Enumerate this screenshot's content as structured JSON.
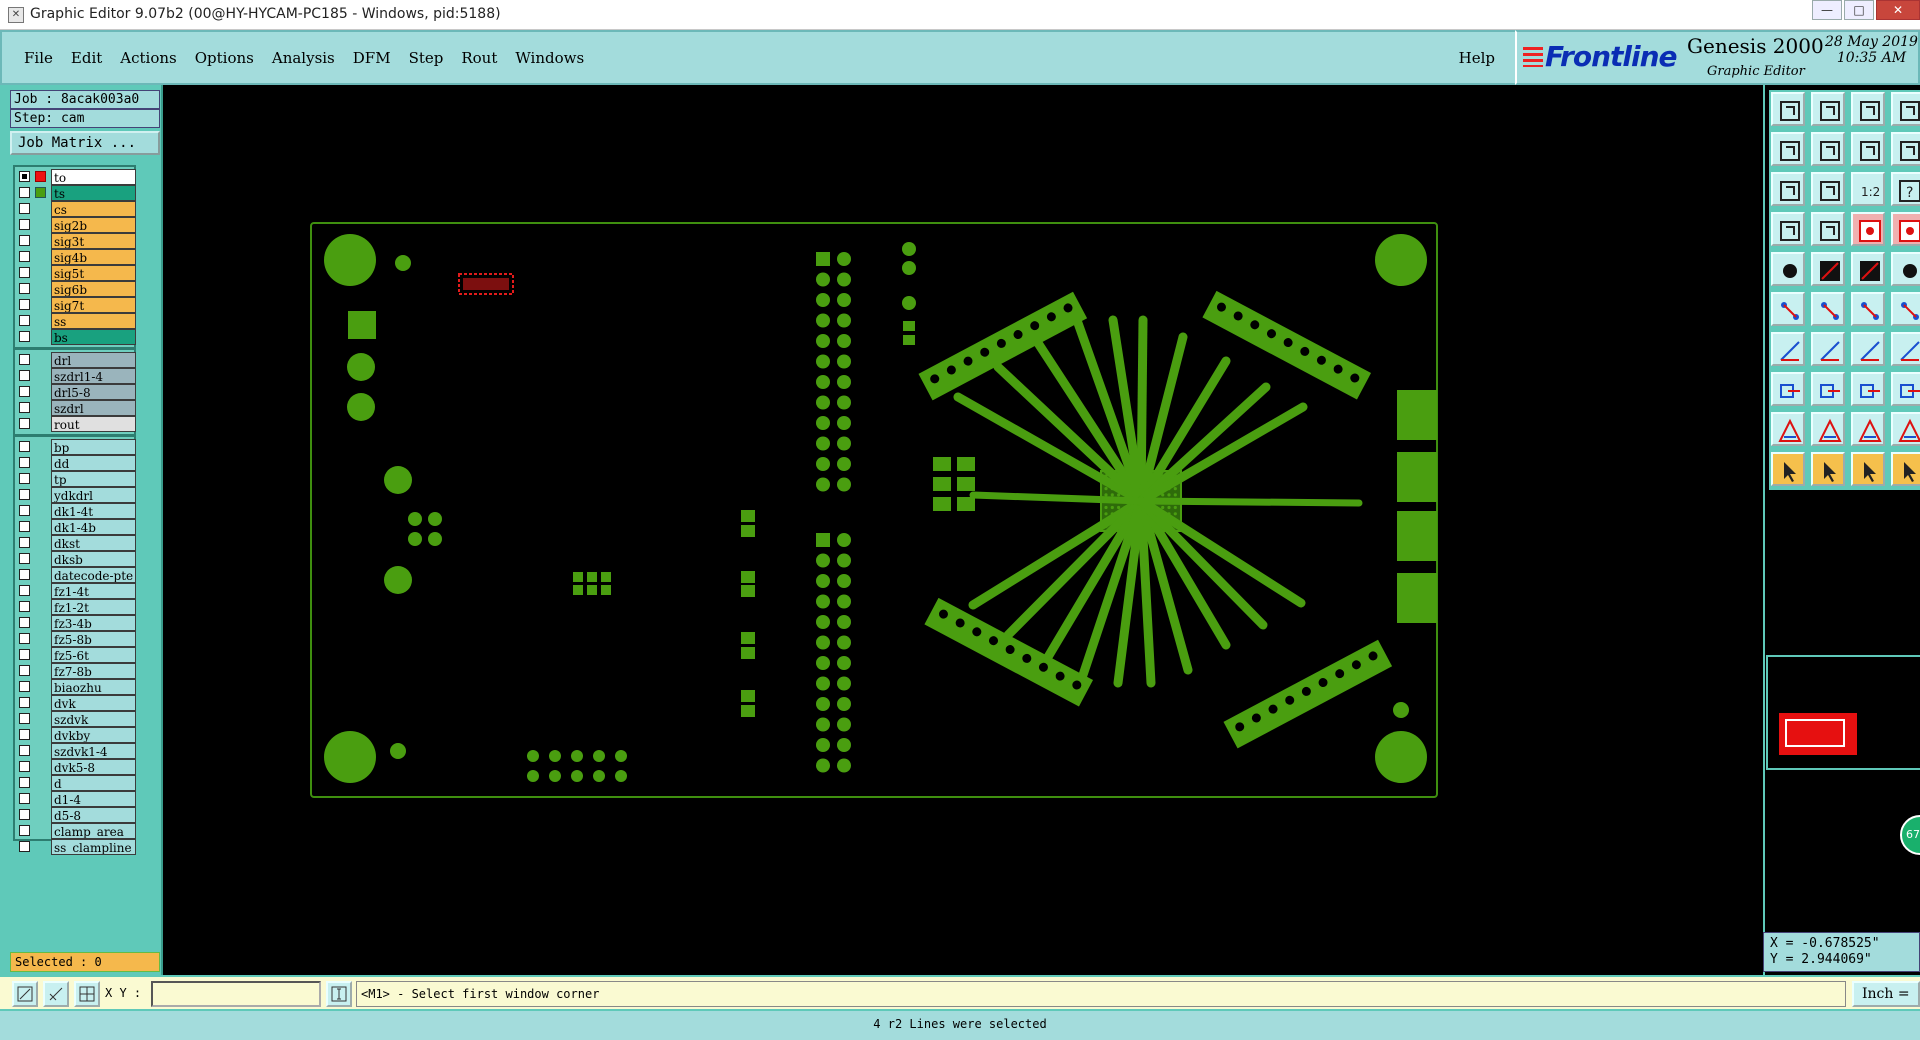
{
  "window": {
    "title": "Graphic Editor 9.07b2 (00@HY-HYCAM-PC185 - Windows, pid:5188)",
    "icon": "app-icon",
    "controls": [
      "minimize",
      "maximize",
      "close"
    ]
  },
  "menubar": {
    "items": [
      "File",
      "Edit",
      "Actions",
      "Options",
      "Analysis",
      "DFM",
      "Step",
      "Rout",
      "Windows"
    ],
    "help": "Help"
  },
  "brand": {
    "logo": "Frontline",
    "product": "Genesis 2000",
    "subtitle": "Graphic Editor",
    "date": "28 May 2019",
    "time": "10:35 AM"
  },
  "job": {
    "job_label": "Job : 8acak003a0",
    "step_label": "Step: cam",
    "matrix_button": "Job Matrix ..."
  },
  "layers": {
    "board": [
      {
        "name": "to",
        "color": "#ffffff",
        "active": true
      },
      {
        "name": "ts",
        "color": "#19a17f"
      },
      {
        "name": "cs",
        "color": "#f5b84c"
      },
      {
        "name": "sig2b",
        "color": "#f5b84c"
      },
      {
        "name": "sig3t",
        "color": "#f5b84c"
      },
      {
        "name": "sig4b",
        "color": "#f5b84c"
      },
      {
        "name": "sig5t",
        "color": "#f5b84c"
      },
      {
        "name": "sig6b",
        "color": "#f5b84c"
      },
      {
        "name": "sig7t",
        "color": "#f5b84c"
      },
      {
        "name": "ss",
        "color": "#f5b84c"
      },
      {
        "name": "bs",
        "color": "#19a17f"
      }
    ],
    "drill": [
      {
        "name": "drl",
        "color": "#9ab4bc"
      },
      {
        "name": "szdrl1-4",
        "color": "#9ab4bc"
      },
      {
        "name": "drl5-8",
        "color": "#9ab4bc"
      },
      {
        "name": "szdrl",
        "color": "#9ab4bc"
      },
      {
        "name": "rout",
        "color": "#e0e0e0"
      }
    ],
    "misc": [
      {
        "name": "bp",
        "color": "#a3dcdc"
      },
      {
        "name": "dd",
        "color": "#a3dcdc"
      },
      {
        "name": "tp",
        "color": "#a3dcdc"
      },
      {
        "name": "ydkdrl",
        "color": "#a3dcdc"
      },
      {
        "name": "dk1-4t",
        "color": "#a3dcdc"
      },
      {
        "name": "dk1-4b",
        "color": "#a3dcdc"
      },
      {
        "name": "dkst",
        "color": "#a3dcdc"
      },
      {
        "name": "dksb",
        "color": "#a3dcdc"
      },
      {
        "name": "datecode-pte",
        "color": "#a3dcdc"
      },
      {
        "name": "fz1-4t",
        "color": "#a3dcdc"
      },
      {
        "name": "fz1-2t",
        "color": "#a3dcdc"
      },
      {
        "name": "fz3-4b",
        "color": "#a3dcdc"
      },
      {
        "name": "fz5-8b",
        "color": "#a3dcdc"
      },
      {
        "name": "fz5-6t",
        "color": "#a3dcdc"
      },
      {
        "name": "fz7-8b",
        "color": "#a3dcdc"
      },
      {
        "name": "biaozhu",
        "color": "#a3dcdc"
      },
      {
        "name": "dvk",
        "color": "#a3dcdc"
      },
      {
        "name": "szdvk",
        "color": "#a3dcdc"
      },
      {
        "name": "dvkby",
        "color": "#a3dcdc"
      },
      {
        "name": "szdvk1-4",
        "color": "#a3dcdc"
      },
      {
        "name": "dvk5-8",
        "color": "#a3dcdc"
      },
      {
        "name": "d",
        "color": "#a3dcdc"
      },
      {
        "name": "d1-4",
        "color": "#a3dcdc"
      },
      {
        "name": "d5-8",
        "color": "#a3dcdc"
      },
      {
        "name": "clamp_area",
        "color": "#a3dcdc"
      },
      {
        "name": "ss_clampline",
        "color": "#a3dcdc"
      }
    ]
  },
  "selected_label": "Selected : 0",
  "pcb": {
    "fill_color": "#4a9e10",
    "outline_color": "#3f8f0f",
    "highlight_color": "#e11b1b"
  },
  "tools": {
    "rows": [
      [
        "home-icon",
        "window-icon",
        "house-icon",
        "layers-icon"
      ],
      [
        "pan-left-icon",
        "pan-right-icon",
        "zoom-toggle-icon",
        "rout-icon"
      ],
      [
        "fit-icon",
        "center-icon",
        "one-to-one-icon",
        "question-icon"
      ],
      [
        "measure-icon",
        "snap-icon",
        "red-bar-icon",
        "red-sort-icon"
      ],
      [
        "feature-icon",
        "cut-icon",
        "line-icon",
        "dot-icon"
      ],
      [
        "node-icon",
        "cross-icon",
        "connect-icon",
        "arc-connect-icon"
      ],
      [
        "angle-icon",
        "slash-icon",
        "arc-icon",
        "flip-icon"
      ],
      [
        "copy-icon",
        "minus-icon",
        "dimension-icon",
        "shape-icon"
      ],
      [
        "triangle-icon",
        "outline-a-icon",
        "filled-a-icon",
        "a-round-icon"
      ],
      [
        "pointer-icon",
        "select-pointer-icon",
        "area-pointer-icon",
        "route-pointer-icon"
      ]
    ]
  },
  "coords": {
    "x": "X = -0.678525\"",
    "y": "Y = 2.944069\""
  },
  "badge_text": "67",
  "inputbar": {
    "xy_label": "X Y :",
    "xy_value": "",
    "prompt": "<M1> - Select first window corner",
    "units": "Inch ="
  },
  "status": "4 r2 Lines were selected"
}
